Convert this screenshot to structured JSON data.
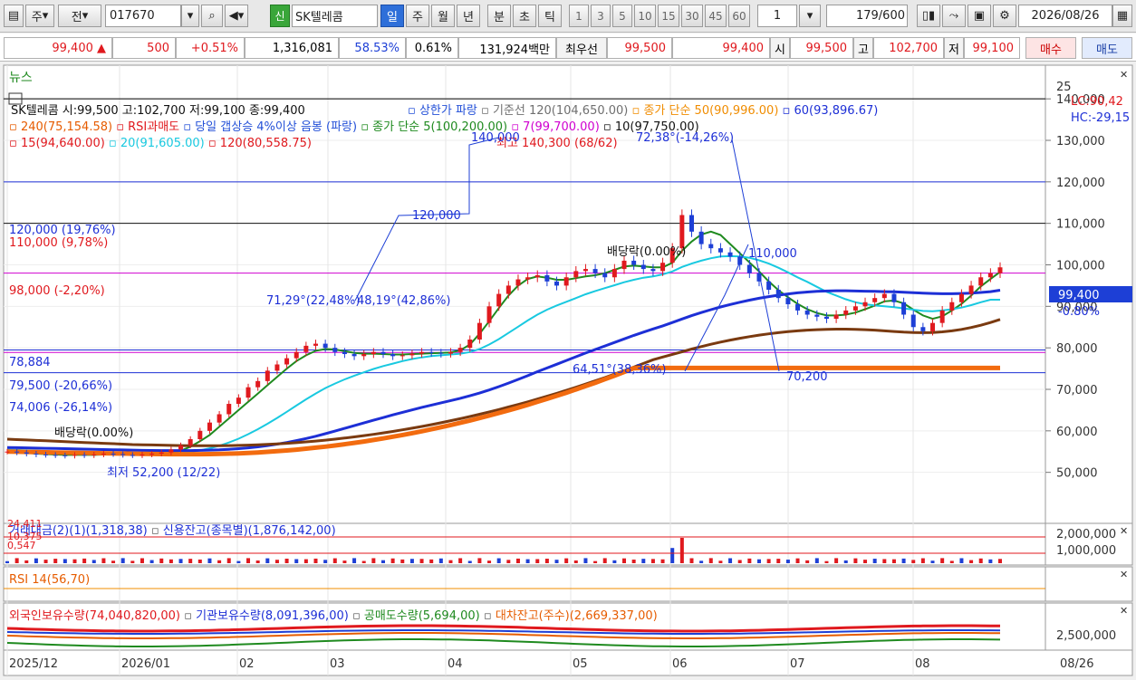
{
  "toolbar": {
    "code_prefix": "주",
    "prev_label": "전",
    "stock_code": "017670",
    "stock_name": "SK텔레콤",
    "credit_badge": "신",
    "periods": [
      "일",
      "주",
      "월",
      "년",
      "분",
      "초",
      "틱"
    ],
    "period_selected": "일",
    "intervals": [
      "1",
      "3",
      "5",
      "10",
      "15",
      "30",
      "45",
      "60"
    ],
    "interval_value": "1",
    "page_position": "179",
    "page_total": "/600",
    "date": "2026/08/26"
  },
  "quote": {
    "price": "99,400 ▲",
    "change": "500",
    "change_pct": "+0.51%",
    "volume": "1,316,081",
    "vol_ratio": "58.53%",
    "turnover": "0.61%",
    "trade_value": "131,924백만",
    "best_label": "최우선",
    "best_ask": "99,500",
    "best_bid": "99,400",
    "open_label": "시",
    "open": "99,500",
    "high_label": "고",
    "high": "102,700",
    "low_label": "저",
    "low": "99,100",
    "buy_label": "매수",
    "sell_label": "매도"
  },
  "chart_data": {
    "type": "candlestick",
    "title": "SK텔레콤 시:99,500 고:102,700 저:99,100 종:99,400",
    "news_label": "뉴스",
    "legend_main": [
      {
        "text": "상한가 파랑",
        "color": "#2350d8"
      },
      {
        "text": "기준선 120(104,650.00)",
        "color": "#6f6f6f"
      },
      {
        "text": "종가 단순 50(90,996.00)",
        "color": "#f08c00"
      },
      {
        "text": "60(93,896.67)",
        "color": "#1d2fd6"
      },
      {
        "text": "240(75,154.58)",
        "color": "#e65c00"
      },
      {
        "text": "RSI과매도",
        "color": "#e0191e"
      },
      {
        "text": "당일 갭상승 4%이상 음봉 (파랑)",
        "color": "#2350d8"
      },
      {
        "text": "종가 단순 5(100,200.00)",
        "color": "#1f8a1f"
      },
      {
        "text": "7(99,700.00)",
        "color": "#d000d0"
      },
      {
        "text": "10(97,750.00)",
        "color": "#111111"
      },
      {
        "text": "15(94,640.00)",
        "color": "#e0191e"
      },
      {
        "text": "20(91,605.00)",
        "color": "#19c9e0"
      },
      {
        "text": "120(80,558.75)",
        "color": "#e0191e"
      }
    ],
    "y_ticks": [
      "140,000",
      "130,000",
      "120,000",
      "110,000",
      "100,000",
      "90,000",
      "80,000",
      "70,000",
      "60,000",
      "50,000"
    ],
    "y_top_label": "25",
    "current_price_tag": "99,400",
    "current_pct_tag": "-0.80%",
    "lc_label": "LC:90,42",
    "hc_label": "HC:-29,15",
    "x_ticks": [
      "2025/12",
      "2026/01",
      "02",
      "03",
      "04",
      "05",
      "06",
      "07",
      "08"
    ],
    "x_end_label": "08/26",
    "annotations": {
      "high_note": "최고 140,300 (68/62)",
      "low_note": "최저 52,200 (12/22)",
      "div1": "배당락(0.00%)",
      "div2": "배당락(0.00%)",
      "line120": "120,000 (19,76%)",
      "line110": "110,000 (9,78%)",
      "line98": "98,000 (-2,20%)",
      "line79_5": "79,500 (-20,66%)",
      "line74": "74,006 (-26,14%)",
      "line78_8": "78,884",
      "trend_120k": "120,000",
      "trend_110k": "110,000",
      "trend_70k": "70,200",
      "trend_140k": "140,000",
      "angle1": "71,29°(22,48%)",
      "angle2": "48,19°(42,86%)",
      "angle3": "64,51°(38,36%)",
      "angle4": "72,38°(-14,26%)"
    },
    "volume_panel": {
      "legend": "거래대금(2)(1)(1,318,38)",
      "legend2": "신용잔고(종목별)(1,876,142,00)",
      "left_a": "24,411",
      "left_b": "10,375",
      "left_c": "0,547",
      "ticks": [
        "2,000,000",
        "1,000,000"
      ]
    },
    "rsi_panel": {
      "legend": "RSI 14(56,70)"
    },
    "flow_panel": {
      "legend1": "외국인보유수량(74,040,820,00)",
      "legend2": "기관보유수량(8,091,396,00)",
      "legend3": "공매도수량(5,694,00)",
      "legend4": "대차잔고(주수)(2,669,337,00)",
      "tick": "2,500,000"
    },
    "series": [
      {
        "name": "close",
        "values": [
          55000,
          54800,
          54500,
          54300,
          54200,
          54100,
          54000,
          54200,
          54100,
          54300,
          54500,
          54400,
          54200,
          54100,
          54300,
          54500,
          54800,
          55500,
          56500,
          58000,
          60000,
          62000,
          64000,
          66500,
          68000,
          70500,
          72000,
          74500,
          76000,
          77500,
          79000,
          80500,
          81000,
          80000,
          79000,
          78500,
          78000,
          78500,
          79000,
          78500,
          78000,
          78200,
          78600,
          79000,
          78800,
          78600,
          79000,
          80000,
          82000,
          86000,
          90000,
          93000,
          95000,
          96500,
          97000,
          97500,
          96000,
          95000,
          97000,
          98500,
          99000,
          98000,
          97000,
          99000,
          101000,
          100000,
          99000,
          98500,
          100500,
          104000,
          112000,
          108000,
          105000,
          104000,
          103000,
          102000,
          100000,
          98000,
          96000,
          94000,
          92000,
          90500,
          89000,
          88000,
          87500,
          87000,
          88000,
          89000,
          90000,
          91000,
          92000,
          93000,
          91000,
          88000,
          85000,
          84000,
          86000,
          89000,
          91000,
          93000,
          95000,
          97000,
          98000,
          99400
        ]
      }
    ],
    "ma_series": [
      {
        "name": "5",
        "color": "#1f8a1f",
        "values": [
          55000,
          54900,
          54700,
          54500,
          54400,
          54300,
          54200,
          54200,
          54200,
          54200,
          54300,
          54350,
          54400,
          54350,
          54300,
          54300,
          54400,
          54700,
          55200,
          56200,
          57500,
          59000,
          61000,
          63000,
          65000,
          67000,
          69000,
          71000,
          73000,
          75000,
          76800,
          78200,
          79300,
          79700,
          79600,
          79200,
          78800,
          78600,
          78600,
          78500,
          78400,
          78400,
          78500,
          78600,
          78700,
          78800,
          78900,
          79400,
          80800,
          83400,
          86400,
          89600,
          92600,
          95000,
          96600,
          97200,
          96900,
          96400,
          96400,
          96800,
          97200,
          97500,
          98000,
          98800,
          99600,
          99800,
          99600,
          99400,
          99400,
          100500,
          103400,
          105600,
          107300,
          108000,
          107200,
          105000,
          102800,
          100600,
          98400,
          96000,
          93900,
          92200,
          90600,
          89300,
          88400,
          87800,
          87800,
          88000,
          88500,
          89300,
          90200,
          91200,
          91400,
          90700,
          89200,
          87800,
          87000,
          87600,
          89000,
          90600,
          92600,
          94800,
          96600,
          98300
        ]
      },
      {
        "name": "20",
        "color": "#19c9e0",
        "values": [
          55500,
          55400,
          55300,
          55200,
          55100,
          55000,
          54900,
          54800,
          54700,
          54600,
          54550,
          54500,
          54450,
          54400,
          54400,
          54400,
          54450,
          54550,
          54700,
          54950,
          55300,
          55800,
          56400,
          57200,
          58100,
          59200,
          60400,
          61700,
          63100,
          64600,
          66100,
          67600,
          69000,
          70300,
          71400,
          72400,
          73300,
          74100,
          74900,
          75600,
          76200,
          76800,
          77300,
          77700,
          78000,
          78200,
          78400,
          78600,
          79000,
          79700,
          80800,
          82100,
          83600,
          85100,
          86600,
          88000,
          89200,
          90200,
          91100,
          92000,
          92900,
          93700,
          94400,
          95100,
          95800,
          96400,
          96900,
          97200,
          97700,
          98400,
          99500,
          100300,
          101000,
          101600,
          102000,
          102100,
          102000,
          101700,
          101100,
          100300,
          99300,
          98200,
          97000,
          95900,
          94700,
          93500,
          92600,
          91700,
          91000,
          90500,
          90200,
          90000,
          89800,
          89500,
          89200,
          88900,
          88800,
          89000,
          89300,
          89700,
          90300,
          91000,
          91600,
          91600
        ]
      },
      {
        "name": "60",
        "color": "#1d2fd6",
        "values": [
          56000,
          55950,
          55900,
          55850,
          55800,
          55750,
          55700,
          55650,
          55600,
          55550,
          55500,
          55450,
          55400,
          55350,
          55300,
          55280,
          55260,
          55250,
          55250,
          55260,
          55300,
          55350,
          55430,
          55550,
          55700,
          55900,
          56150,
          56450,
          56800,
          57200,
          57650,
          58150,
          58700,
          59300,
          59950,
          60600,
          61250,
          61900,
          62550,
          63200,
          63850,
          64450,
          65050,
          65650,
          66200,
          66750,
          67300,
          67850,
          68450,
          69100,
          69850,
          70650,
          71500,
          72400,
          73300,
          74250,
          75150,
          76050,
          76950,
          77850,
          78750,
          79600,
          80450,
          81300,
          82150,
          83000,
          83800,
          84550,
          85300,
          86100,
          86950,
          87750,
          88500,
          89200,
          89850,
          90450,
          91000,
          91500,
          91950,
          92350,
          92700,
          93000,
          93250,
          93450,
          93600,
          93700,
          93750,
          93750,
          93700,
          93650,
          93600,
          93550,
          93500,
          93400,
          93300,
          93200,
          93100,
          93050,
          93050,
          93100,
          93200,
          93350,
          93550,
          93896
        ]
      },
      {
        "name": "120",
        "color": "#7a3a10",
        "values": [
          58000,
          57900,
          57800,
          57700,
          57600,
          57500,
          57400,
          57300,
          57200,
          57100,
          57000,
          56900,
          56800,
          56700,
          56650,
          56600,
          56550,
          56500,
          56450,
          56400,
          56400,
          56400,
          56420,
          56450,
          56500,
          56560,
          56640,
          56740,
          56860,
          57000,
          57160,
          57340,
          57540,
          57760,
          58000,
          58260,
          58540,
          58840,
          59160,
          59500,
          59860,
          60240,
          60640,
          61060,
          61500,
          61960,
          62440,
          62940,
          63460,
          64000,
          64560,
          65140,
          65740,
          66360,
          67000,
          67660,
          68340,
          69040,
          69760,
          70500,
          71260,
          72040,
          72840,
          73660,
          74500,
          75360,
          76240,
          77140,
          77780,
          78420,
          79060,
          79700,
          80300,
          80860,
          81380,
          81860,
          82300,
          82700,
          83060,
          83380,
          83660,
          83900,
          84100,
          84260,
          84380,
          84460,
          84500,
          84500,
          84460,
          84380,
          84260,
          84100,
          83950,
          83800,
          83700,
          83650,
          83700,
          83850,
          84100,
          84450,
          84900,
          85450,
          86100,
          86850
        ]
      },
      {
        "name": "240",
        "color": "#f26b0f",
        "values": [
          55000,
          54960,
          54920,
          54880,
          54840,
          54800,
          54760,
          54720,
          54680,
          54640,
          54600,
          54560,
          54520,
          54480,
          54450,
          54420,
          54400,
          54380,
          54370,
          54370,
          54380,
          54400,
          54440,
          54500,
          54580,
          54680,
          54800,
          54940,
          55100,
          55280,
          55480,
          55700,
          55940,
          56200,
          56480,
          56780,
          57100,
          57440,
          57800,
          58180,
          58580,
          59000,
          59440,
          59900,
          60380,
          60880,
          61400,
          61940,
          62500,
          63080,
          63680,
          64300,
          64940,
          65600,
          66280,
          66980,
          67700,
          68440,
          69200,
          69980,
          70780,
          71600,
          72440,
          73300,
          74180,
          75080,
          75150,
          75150,
          75150,
          75150,
          75150,
          75150,
          75150,
          75150,
          75150,
          75150,
          75150,
          75150,
          75150,
          75150,
          75150,
          75150,
          75150,
          75150,
          75150,
          75150,
          75150,
          75150,
          75150,
          75150,
          75150,
          75150,
          75150,
          75150,
          75150,
          75150,
          75150,
          75150,
          75150,
          75150,
          75150,
          75150,
          75150,
          75154
        ]
      }
    ],
    "ylim": [
      46000,
      142000
    ]
  },
  "colors": {
    "up": "#e0191e",
    "down": "#1d3fd6",
    "grid": "#d9d9d9",
    "panel_bg": "#ffffff",
    "selected": "#2e6fd9"
  }
}
